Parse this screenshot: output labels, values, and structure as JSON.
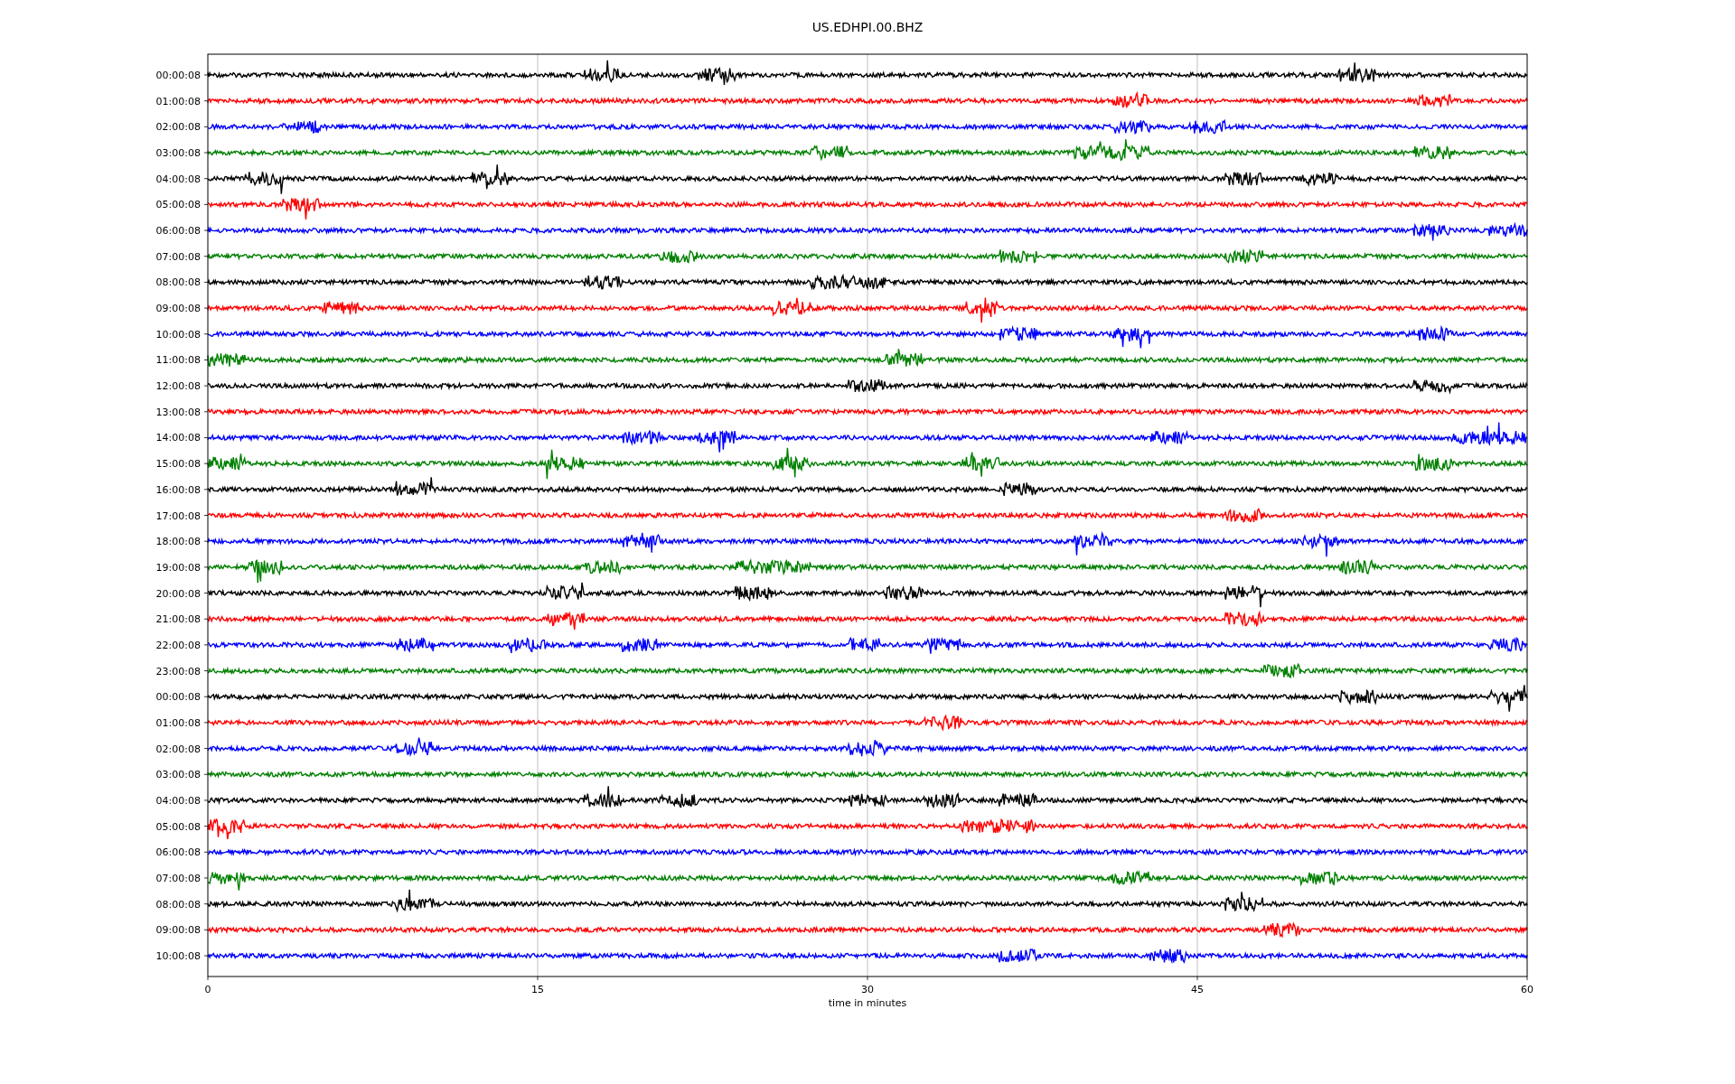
{
  "plot": {
    "title": "US.EDHPI.00.BHZ",
    "xlabel": "time in minutes",
    "xticks": [
      "0",
      "15",
      "30",
      "45",
      "60"
    ],
    "rows": [
      {
        "label": "00:00:08",
        "color": "#000000"
      },
      {
        "label": "01:00:08",
        "color": "#ff0000"
      },
      {
        "label": "02:00:08",
        "color": "#0000ff"
      },
      {
        "label": "03:00:08",
        "color": "#008000"
      },
      {
        "label": "04:00:08",
        "color": "#000000"
      },
      {
        "label": "05:00:08",
        "color": "#ff0000"
      },
      {
        "label": "06:00:08",
        "color": "#0000ff"
      },
      {
        "label": "07:00:08",
        "color": "#008000"
      },
      {
        "label": "08:00:08",
        "color": "#000000"
      },
      {
        "label": "09:00:08",
        "color": "#ff0000"
      },
      {
        "label": "10:00:08",
        "color": "#0000ff"
      },
      {
        "label": "11:00:08",
        "color": "#008000"
      },
      {
        "label": "12:00:08",
        "color": "#000000"
      },
      {
        "label": "13:00:08",
        "color": "#ff0000"
      },
      {
        "label": "14:00:08",
        "color": "#0000ff"
      },
      {
        "label": "15:00:08",
        "color": "#008000"
      },
      {
        "label": "16:00:08",
        "color": "#000000"
      },
      {
        "label": "17:00:08",
        "color": "#ff0000"
      },
      {
        "label": "18:00:08",
        "color": "#0000ff"
      },
      {
        "label": "19:00:08",
        "color": "#008000"
      },
      {
        "label": "20:00:08",
        "color": "#000000"
      },
      {
        "label": "21:00:08",
        "color": "#ff0000"
      },
      {
        "label": "22:00:08",
        "color": "#0000ff"
      },
      {
        "label": "23:00:08",
        "color": "#008000"
      },
      {
        "label": "00:00:08",
        "color": "#000000"
      },
      {
        "label": "01:00:08",
        "color": "#ff0000"
      },
      {
        "label": "02:00:08",
        "color": "#0000ff"
      },
      {
        "label": "03:00:08",
        "color": "#008000"
      },
      {
        "label": "04:00:08",
        "color": "#000000"
      },
      {
        "label": "05:00:08",
        "color": "#ff0000"
      },
      {
        "label": "06:00:08",
        "color": "#0000ff"
      },
      {
        "label": "07:00:08",
        "color": "#008000"
      },
      {
        "label": "08:00:08",
        "color": "#000000"
      },
      {
        "label": "09:00:08",
        "color": "#ff0000"
      },
      {
        "label": "10:00:08",
        "color": "#0000ff"
      }
    ]
  }
}
